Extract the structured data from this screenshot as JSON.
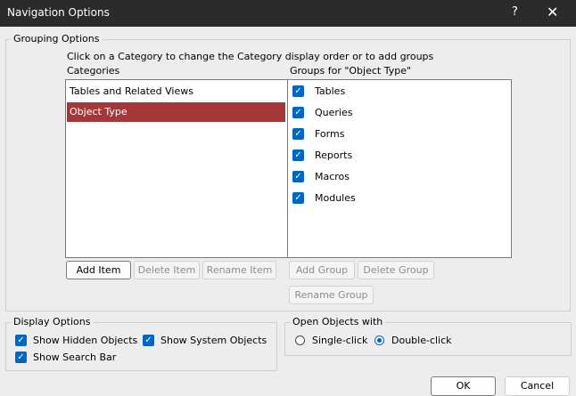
{
  "window": {
    "title": "Navigation Options",
    "help_glyph": "?",
    "close_glyph": "✕"
  },
  "grouping": {
    "legend": "Grouping Options",
    "hint": "Click on a Category to change the Category display order or to add groups",
    "categories_label": "Categories",
    "groups_label": "Groups for \"Object Type\"",
    "categories": [
      {
        "label": "Tables and Related Views",
        "selected": false
      },
      {
        "label": "Object Type",
        "selected": true
      }
    ],
    "groups": [
      {
        "label": "Tables",
        "checked": true
      },
      {
        "label": "Queries",
        "checked": true
      },
      {
        "label": "Forms",
        "checked": true
      },
      {
        "label": "Reports",
        "checked": true
      },
      {
        "label": "Macros",
        "checked": true
      },
      {
        "label": "Modules",
        "checked": true
      }
    ],
    "buttons": {
      "add_item": "Add Item",
      "delete_item": "Delete Item",
      "rename_item": "Rename Item",
      "add_group": "Add Group",
      "delete_group": "Delete Group",
      "rename_group": "Rename Group"
    }
  },
  "display": {
    "legend": "Display Options",
    "show_hidden": {
      "label": "Show Hidden Objects",
      "checked": true
    },
    "show_system": {
      "label": "Show System Objects",
      "checked": true
    },
    "show_search": {
      "label": "Show Search Bar",
      "checked": true
    }
  },
  "open_objects": {
    "legend": "Open Objects with",
    "single_click": {
      "label": "Single-click",
      "selected": false
    },
    "double_click": {
      "label": "Double-click",
      "selected": true
    }
  },
  "footer": {
    "ok": "OK",
    "cancel": "Cancel"
  },
  "icons": {
    "checkmark": "✓"
  },
  "colors": {
    "selection": "#a4373a",
    "accent": "#0067c0",
    "titlebar": "#2b2b2b"
  }
}
